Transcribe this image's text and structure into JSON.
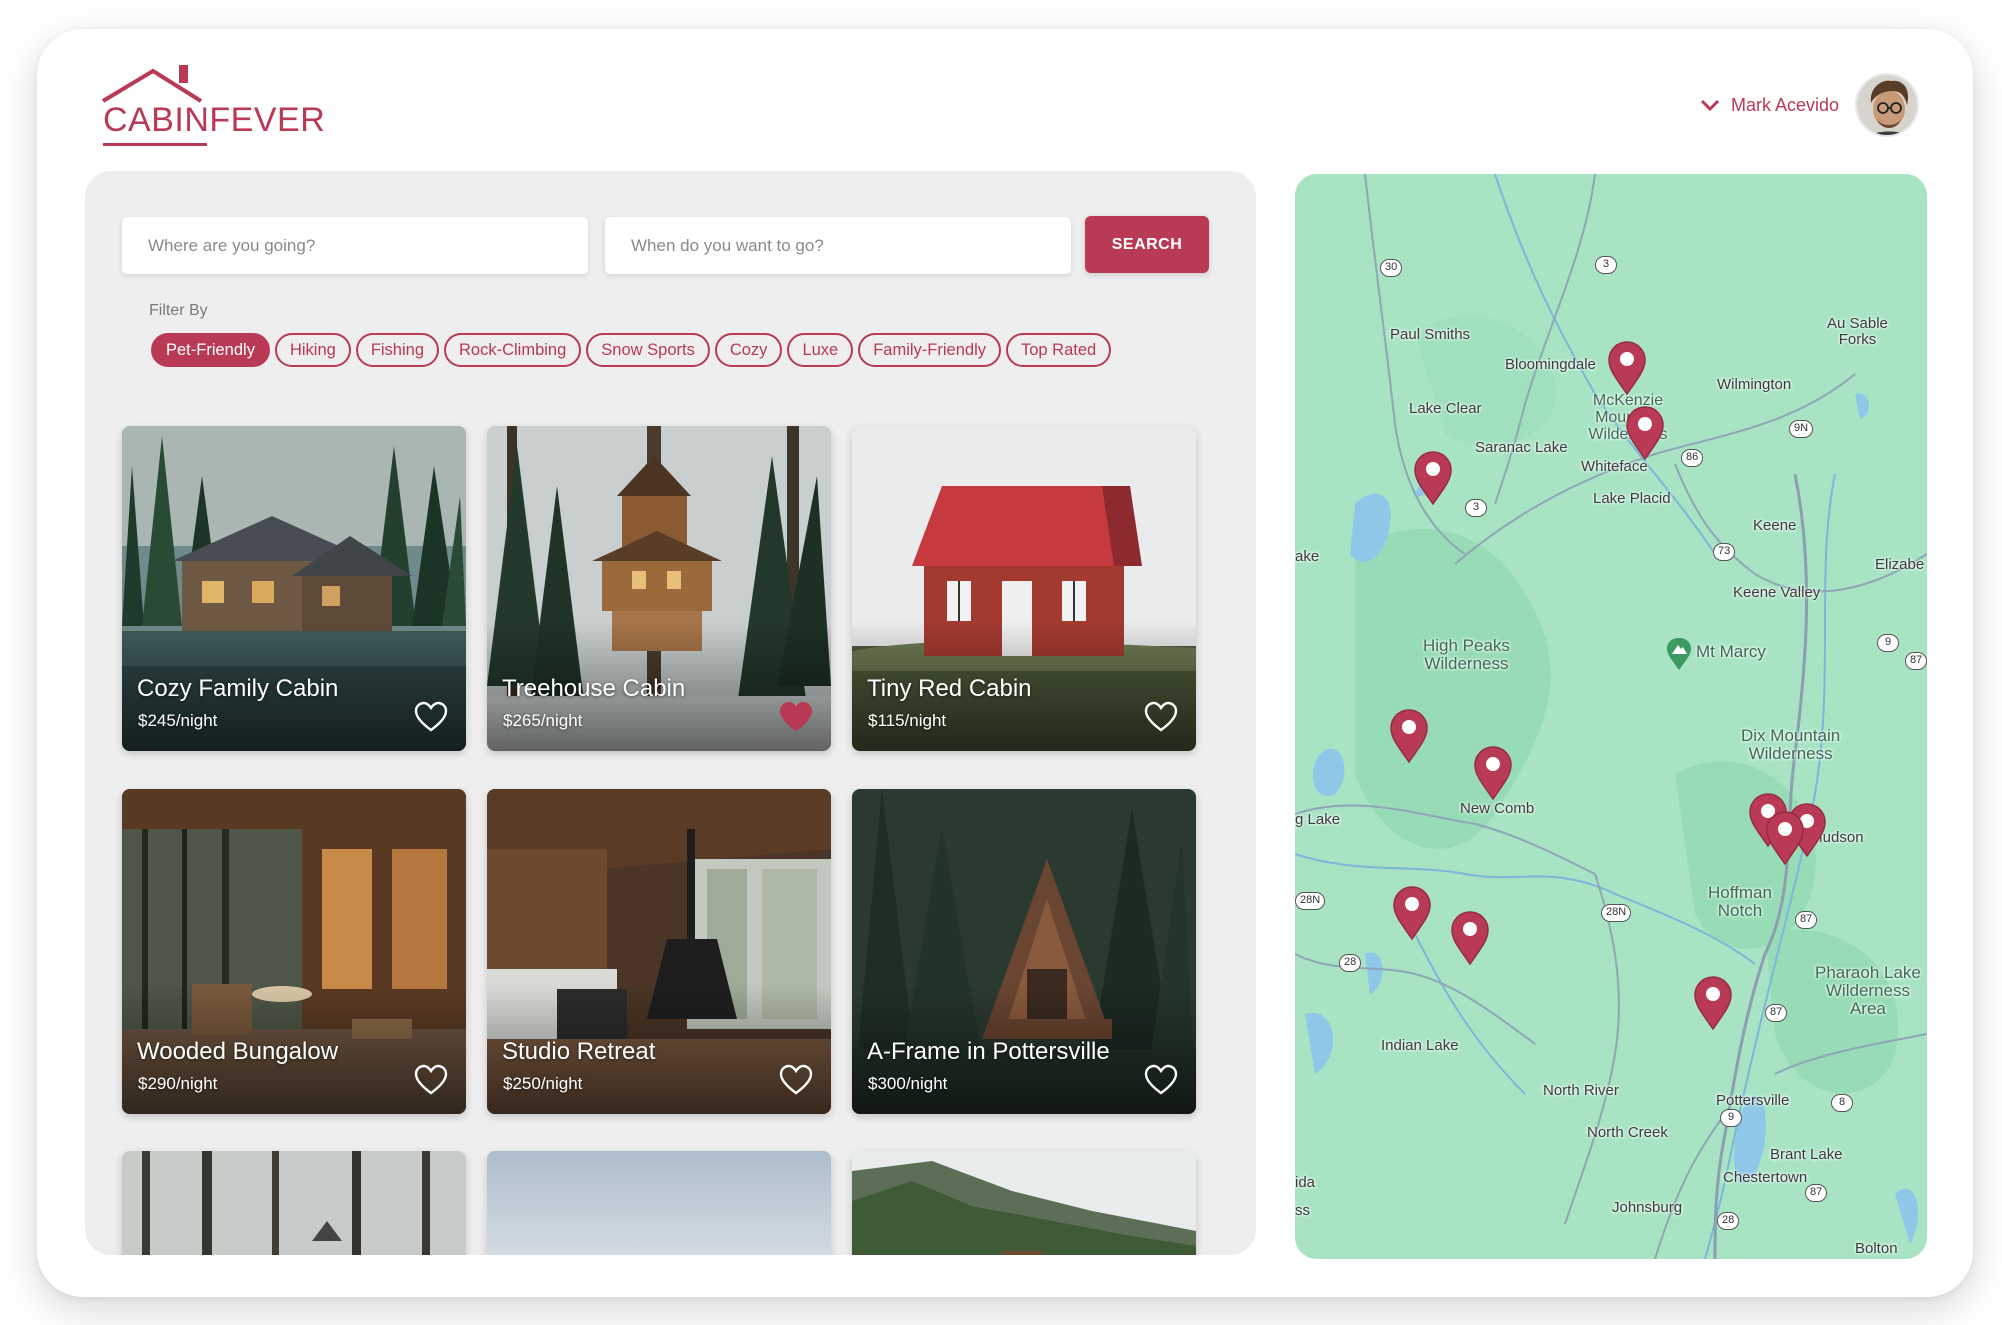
{
  "brand": {
    "name": "CABINFEVER",
    "color": "#b83a54"
  },
  "user": {
    "name": "Mark Acevido"
  },
  "search": {
    "where_placeholder": "Where are you going?",
    "when_placeholder": "When do you want to go?",
    "button": "SEARCH"
  },
  "filters": {
    "label": "Filter By",
    "chips": [
      {
        "label": "Pet-Friendly",
        "active": true
      },
      {
        "label": "Hiking",
        "active": false
      },
      {
        "label": "Fishing",
        "active": false
      },
      {
        "label": "Rock-Climbing",
        "active": false
      },
      {
        "label": "Snow Sports",
        "active": false
      },
      {
        "label": "Cozy",
        "active": false
      },
      {
        "label": "Luxe",
        "active": false
      },
      {
        "label": "Family-Friendly",
        "active": false
      },
      {
        "label": "Top Rated",
        "active": false
      }
    ]
  },
  "listings": [
    {
      "title": "Cozy Family Cabin",
      "price": "$245/night",
      "favorited": false
    },
    {
      "title": "Treehouse Cabin",
      "price": "$265/night",
      "favorited": true
    },
    {
      "title": "Tiny Red Cabin",
      "price": "$115/night",
      "favorited": false
    },
    {
      "title": "Wooded Bungalow",
      "price": "$290/night",
      "favorited": false
    },
    {
      "title": "Studio Retreat",
      "price": "$250/night",
      "favorited": false
    },
    {
      "title": "A-Frame in Pottersville",
      "price": "$300/night",
      "favorited": false
    }
  ],
  "map": {
    "places": [
      "Paul Smiths",
      "Bloomingdale",
      "Au Sable\nForks",
      "Wilmington",
      "Lake Clear",
      "Saranac Lake",
      "Whiteface",
      "Lake Placid",
      "Keene",
      "Elizabe",
      "Keene Valley",
      "Mt Marcy",
      "New Comb",
      "North Hudson",
      "Indian Lake",
      "North River",
      "North Creek",
      "Pottersville",
      "Brant Lake",
      "Chestertown",
      "Johnsburg",
      "Bolton",
      "ake",
      "g Lake",
      "ida",
      "ss",
      "McKenzie Mountain Wilderness"
    ],
    "regions": [
      "High Peaks\nWilderness",
      "Dix Mountain\nWilderness",
      "Hoffman\nNotch",
      "Pharaoh Lake\nWilderness\nArea"
    ],
    "routes": [
      "30",
      "3",
      "9N",
      "86",
      "3",
      "73",
      "9",
      "87",
      "28N",
      "28",
      "28N",
      "87",
      "87",
      "9",
      "8",
      "28",
      "87"
    ],
    "pin_count": 11
  }
}
